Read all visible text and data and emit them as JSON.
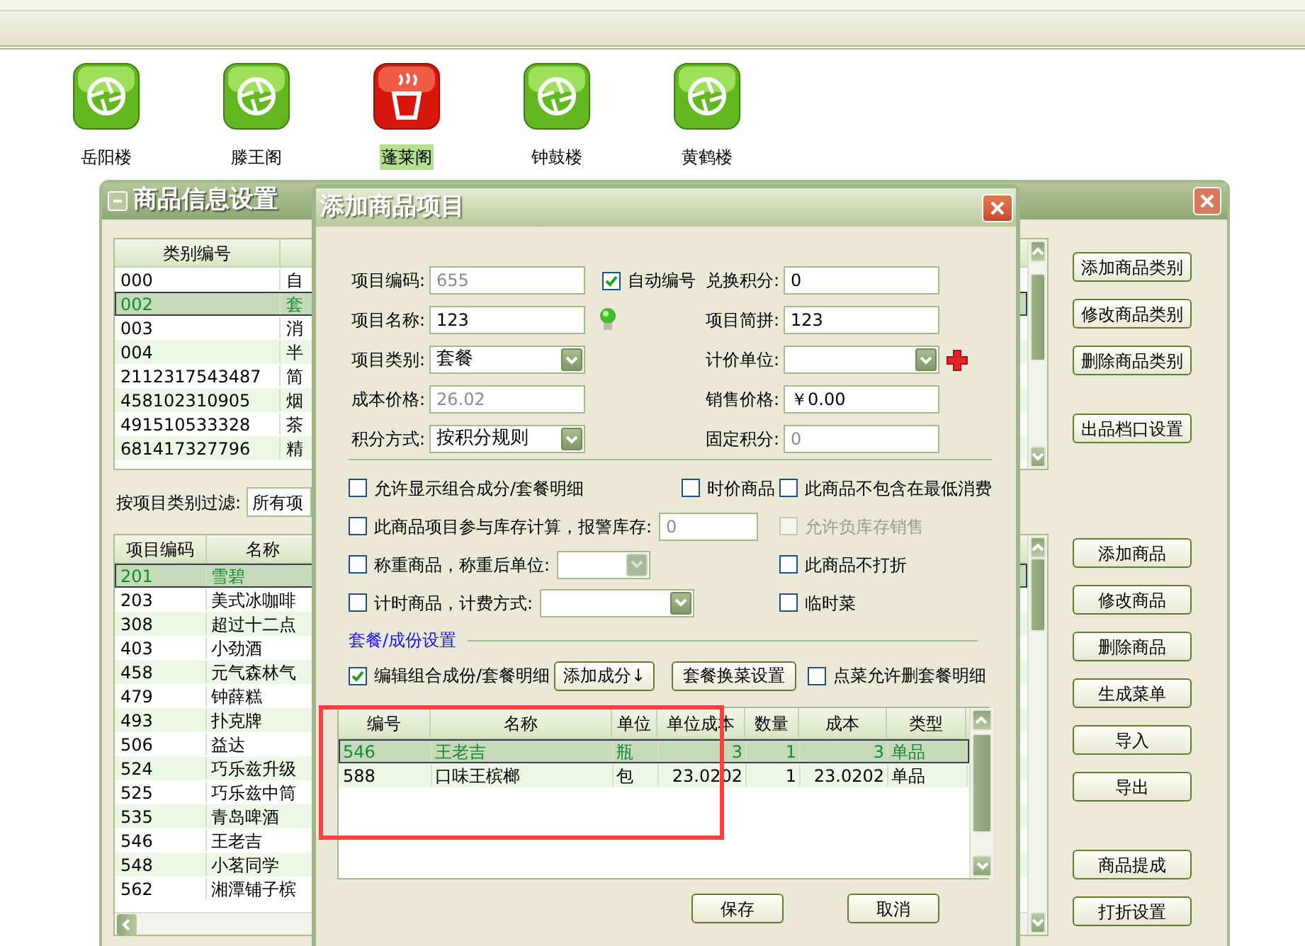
{
  "toolbar_icons": [
    {
      "label": "岳阳楼",
      "selected": false
    },
    {
      "label": "滕王阁",
      "selected": false
    },
    {
      "label": "蓬莱阁",
      "selected": true
    },
    {
      "label": "钟鼓楼",
      "selected": false
    },
    {
      "label": "黄鹤楼",
      "selected": false
    }
  ],
  "back_window": {
    "title": "商品信息设置",
    "category_table": {
      "columns": [
        "类别编号"
      ],
      "rows": [
        {
          "code": "000",
          "name": "自",
          "selected": false
        },
        {
          "code": "002",
          "name": "套",
          "selected": true
        },
        {
          "code": "003",
          "name": "消",
          "selected": false
        },
        {
          "code": "004",
          "name": "半",
          "selected": false
        },
        {
          "code": "2112317543487",
          "name": "简",
          "selected": false
        },
        {
          "code": "458102310905",
          "name": "烟",
          "selected": false
        },
        {
          "code": "491510533328",
          "name": "茶",
          "selected": false
        },
        {
          "code": "681417327796",
          "name": "精",
          "selected": false
        }
      ]
    },
    "filter": {
      "label": "按项目类别过滤:",
      "value": "所有项"
    },
    "item_table": {
      "columns": [
        "项目编码",
        "名称"
      ],
      "rows": [
        {
          "code": "201",
          "name": "雪碧",
          "selected": true
        },
        {
          "code": "203",
          "name": "美式冰咖啡",
          "selected": false
        },
        {
          "code": "308",
          "name": "超过十二点",
          "selected": false
        },
        {
          "code": "403",
          "name": "小劲酒",
          "selected": false
        },
        {
          "code": "458",
          "name": "元气森林气",
          "selected": false
        },
        {
          "code": "479",
          "name": "钟薛糕",
          "selected": false
        },
        {
          "code": "493",
          "name": "扑克牌",
          "selected": false
        },
        {
          "code": "506",
          "name": "益达",
          "selected": false
        },
        {
          "code": "524",
          "name": "巧乐兹升级",
          "selected": false
        },
        {
          "code": "525",
          "name": "巧乐兹中筒",
          "selected": false
        },
        {
          "code": "535",
          "name": "青岛啤酒",
          "selected": false
        },
        {
          "code": "546",
          "name": "王老吉",
          "selected": false
        },
        {
          "code": "548",
          "name": "小茗同学",
          "selected": false
        },
        {
          "code": "562",
          "name": "湘潭铺子槟",
          "selected": false
        }
      ]
    },
    "button_groups": [
      [
        "添加商品类别",
        "修改商品类别",
        "删除商品类别"
      ],
      [
        "出品档口设置"
      ],
      [
        "添加商品",
        "修改商品",
        "删除商品",
        "生成菜单",
        "导入",
        "导出"
      ],
      [
        "商品提成",
        "打折设置"
      ]
    ]
  },
  "dialog": {
    "title": "添加商品项目",
    "field_rows": [
      {
        "left": {
          "label": "项目编码:",
          "kind": "input",
          "value": "655",
          "disabled": true
        },
        "middle": {
          "kind": "checkbox",
          "label": "自动编号",
          "checked": true
        },
        "right": {
          "label": "兑换积分:",
          "kind": "input",
          "value": "0",
          "disabled": false
        }
      },
      {
        "left": {
          "label": "项目名称:",
          "kind": "input",
          "value": "123",
          "disabled": false
        },
        "middle": {
          "kind": "bulb"
        },
        "right": {
          "label": "项目简拼:",
          "kind": "input",
          "value": "123",
          "disabled": false
        }
      },
      {
        "left": {
          "label": "项目类别:",
          "kind": "select",
          "value": "套餐",
          "disabled": false
        },
        "right": {
          "label": "计价单位:",
          "kind": "select",
          "disabled": false,
          "add_button": true
        }
      },
      {
        "left": {
          "label": "成本价格:",
          "kind": "input",
          "value": "26.02",
          "disabled": true
        },
        "right": {
          "label": "销售价格:",
          "kind": "input",
          "value": "￥0.00",
          "disabled": false
        }
      },
      {
        "left": {
          "label": "积分方式:",
          "kind": "select",
          "value": "按积分规则",
          "disabled": false
        },
        "right": {
          "label": "固定积分:",
          "kind": "input",
          "value": "0",
          "disabled": true
        }
      }
    ],
    "option_rows": [
      {
        "left": [
          {
            "kind": "checkbox",
            "label": "允许显示组合成分/套餐明细",
            "checked": false,
            "disabled": false
          },
          {
            "kind": "checkbox",
            "label": "时价商品",
            "checked": false,
            "disabled": false
          }
        ],
        "right": {
          "label": "此商品不包含在最低消费",
          "checked": false,
          "disabled": false
        }
      },
      {
        "left": [
          {
            "kind": "checkbox",
            "label": "此商品项目参与库存计算，报警库存:",
            "checked": false,
            "disabled": false
          },
          {
            "kind": "input",
            "value": "0",
            "disabled": true
          }
        ],
        "right": {
          "label": "允许负库存销售",
          "checked": false,
          "disabled": true
        }
      },
      {
        "left": [
          {
            "kind": "checkbox",
            "label": "称重商品，称重后单位:",
            "checked": false,
            "disabled": false
          },
          {
            "kind": "select",
            "disabled": true
          }
        ],
        "right": {
          "label": "此商品不打折",
          "checked": false,
          "disabled": false
        }
      },
      {
        "left": [
          {
            "kind": "checkbox",
            "label": "计时商品，计费方式:",
            "checked": false,
            "disabled": false
          },
          {
            "kind": "select",
            "disabled": false
          }
        ],
        "right": {
          "label": "临时菜",
          "checked": false,
          "disabled": false
        }
      }
    ],
    "section_title": "套餐/成份设置",
    "composition_controls": [
      {
        "kind": "checkbox",
        "label": "编辑组合成份/套餐明细",
        "checked": true
      },
      {
        "kind": "button",
        "label": "添加成分↓"
      },
      {
        "kind": "button",
        "label": "套餐换菜设置"
      },
      {
        "kind": "checkbox",
        "label": "点菜允许删套餐明细",
        "checked": false
      }
    ],
    "table": {
      "columns": [
        "编号",
        "名称",
        "单位",
        "单位成本",
        "数量",
        "成本",
        "类型"
      ],
      "rows": [
        {
          "cells": [
            "546",
            "王老吉",
            "瓶",
            "3",
            "1",
            "3",
            "单品"
          ],
          "selected": true
        },
        {
          "cells": [
            "588",
            "口味王槟榔",
            "包",
            "23.0202",
            "1",
            "23.0202",
            "单品"
          ],
          "selected": false
        }
      ]
    },
    "buttons": [
      "保存",
      "取消"
    ]
  }
}
